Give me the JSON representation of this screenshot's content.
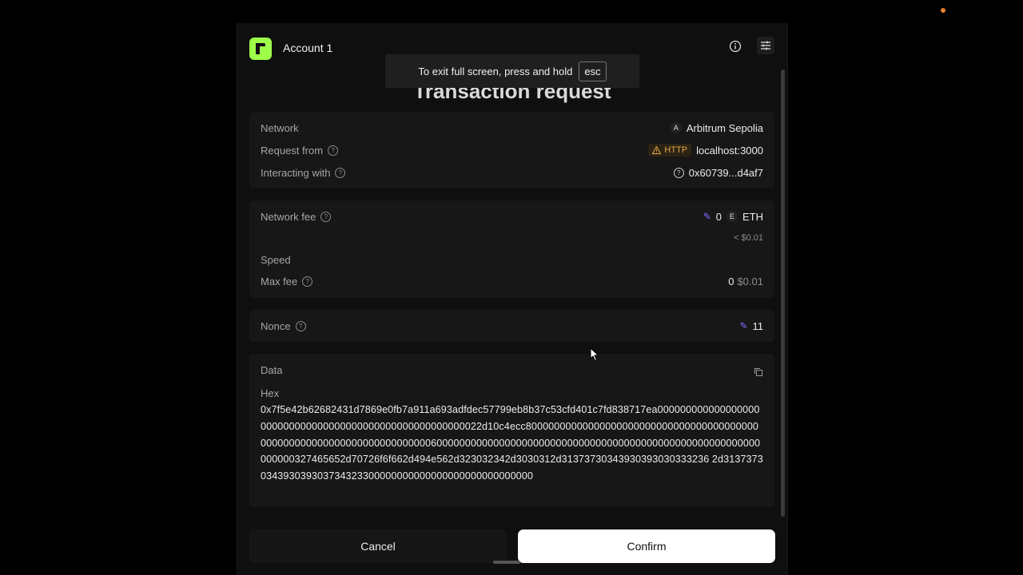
{
  "colors": {
    "accent": "#7b6cff",
    "brand": "#9dff4a",
    "warning": "#e2a542",
    "dot": "#e8812f"
  },
  "header": {
    "account_name": "Account 1",
    "icons": [
      "logo-icon",
      "info-icon",
      "settings-sliders-icon"
    ]
  },
  "toast": {
    "message": "To exit full screen, press and hold",
    "key": "esc"
  },
  "title": "Transaction request",
  "details": {
    "network_label": "Network",
    "network_badge": "A",
    "network_value": "Arbitrum Sepolia",
    "request_from_label": "Request from",
    "http_badge": "HTTP",
    "request_from_value": "localhost:3000",
    "interacting_label": "Interacting with",
    "interacting_value": "0x60739...d4af7"
  },
  "fee": {
    "network_fee_label": "Network fee",
    "network_fee_value": "0",
    "token_badge": "E",
    "token": "ETH",
    "fee_usd": "< $0.01",
    "speed_label": "Speed",
    "max_fee_label": "Max fee",
    "max_fee_value": "0",
    "max_fee_usd": "$0.01"
  },
  "nonce": {
    "label": "Nonce",
    "value": "11"
  },
  "data": {
    "label": "Data",
    "hex_label": "Hex",
    "hex_value": "0x7f5e42b62682431d7869e0fb7a911a693adfdec57799eb8b37c53cfd401c7fd838717ea000000000000000000000000000000000000000000000000000000022d10c4ecc800000000000000000000000000000000000000000000000000000000000000000000006000000000000000000000000000000000000000000000000000000000000000327465652d70726f6f662d494e562d323032342d3030312d31373730343930393030333236 2d3137373034393039303734323300000000000000000000000000000"
  },
  "actions": {
    "cancel": "Cancel",
    "confirm": "Confirm"
  }
}
